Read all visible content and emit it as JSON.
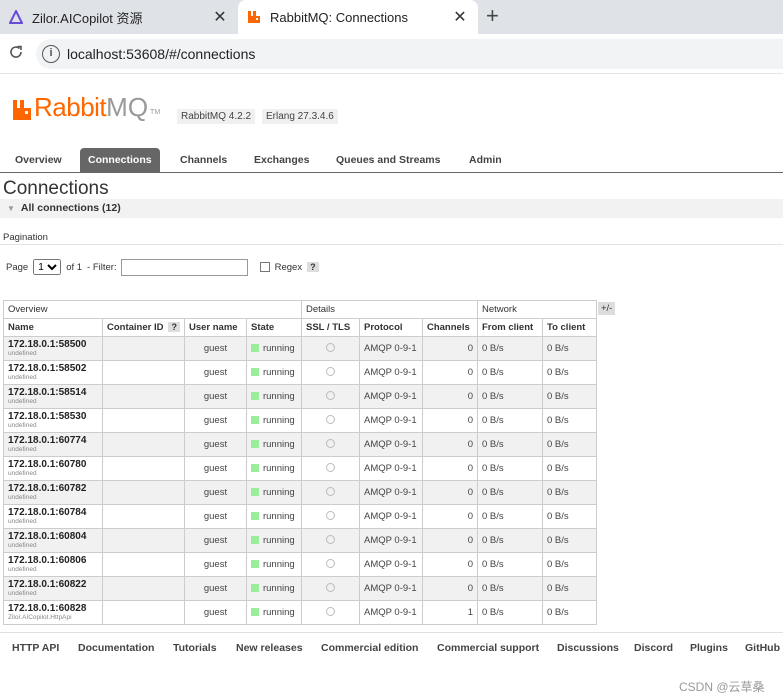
{
  "browser": {
    "tabs": [
      {
        "label": "Zilor.AICopilot 资源",
        "icon": "zilor-triangle-icon"
      },
      {
        "label": "RabbitMQ: Connections",
        "icon": "rabbitmq-icon"
      }
    ],
    "close_glyph": "✕",
    "new_tab_glyph": "+",
    "url": "localhost:53608/#/connections"
  },
  "header": {
    "logo_rabbit": "Rabbit",
    "logo_mq": "MQ",
    "logo_tm": "TM",
    "version": "RabbitMQ 4.2.2",
    "erlang": "Erlang 27.3.4.6"
  },
  "nav": [
    "Overview",
    "Connections",
    "Channels",
    "Exchanges",
    "Queues and Streams",
    "Admin"
  ],
  "page": {
    "title": "Connections",
    "section": "All connections (12)"
  },
  "pagination": {
    "label": "Pagination",
    "page_label": "Page",
    "page_value": "1",
    "of_label": "of 1",
    "filter_label": "- Filter:",
    "regex_label": "Regex",
    "help": "?"
  },
  "table": {
    "groups": [
      "Overview",
      "Details",
      "Network"
    ],
    "plusminus": "+/-",
    "columns": [
      "Name",
      "Container ID",
      "User name",
      "State",
      "SSL / TLS",
      "Protocol",
      "Channels",
      "From client",
      "To client"
    ],
    "rows": [
      {
        "name": "172.18.0.1:58500",
        "sub": "undefined",
        "user": "guest",
        "state": "running",
        "protocol": "AMQP 0-9-1",
        "channels": "0",
        "from": "0 B/s",
        "to": "0 B/s"
      },
      {
        "name": "172.18.0.1:58502",
        "sub": "undefined",
        "user": "guest",
        "state": "running",
        "protocol": "AMQP 0-9-1",
        "channels": "0",
        "from": "0 B/s",
        "to": "0 B/s"
      },
      {
        "name": "172.18.0.1:58514",
        "sub": "undefined",
        "user": "guest",
        "state": "running",
        "protocol": "AMQP 0-9-1",
        "channels": "0",
        "from": "0 B/s",
        "to": "0 B/s"
      },
      {
        "name": "172.18.0.1:58530",
        "sub": "undefined",
        "user": "guest",
        "state": "running",
        "protocol": "AMQP 0-9-1",
        "channels": "0",
        "from": "0 B/s",
        "to": "0 B/s"
      },
      {
        "name": "172.18.0.1:60774",
        "sub": "undefined",
        "user": "guest",
        "state": "running",
        "protocol": "AMQP 0-9-1",
        "channels": "0",
        "from": "0 B/s",
        "to": "0 B/s"
      },
      {
        "name": "172.18.0.1:60780",
        "sub": "undefined",
        "user": "guest",
        "state": "running",
        "protocol": "AMQP 0-9-1",
        "channels": "0",
        "from": "0 B/s",
        "to": "0 B/s"
      },
      {
        "name": "172.18.0.1:60782",
        "sub": "undefined",
        "user": "guest",
        "state": "running",
        "protocol": "AMQP 0-9-1",
        "channels": "0",
        "from": "0 B/s",
        "to": "0 B/s"
      },
      {
        "name": "172.18.0.1:60784",
        "sub": "undefined",
        "user": "guest",
        "state": "running",
        "protocol": "AMQP 0-9-1",
        "channels": "0",
        "from": "0 B/s",
        "to": "0 B/s"
      },
      {
        "name": "172.18.0.1:60804",
        "sub": "undefined",
        "user": "guest",
        "state": "running",
        "protocol": "AMQP 0-9-1",
        "channels": "0",
        "from": "0 B/s",
        "to": "0 B/s"
      },
      {
        "name": "172.18.0.1:60806",
        "sub": "undefined",
        "user": "guest",
        "state": "running",
        "protocol": "AMQP 0-9-1",
        "channels": "0",
        "from": "0 B/s",
        "to": "0 B/s"
      },
      {
        "name": "172.18.0.1:60822",
        "sub": "undefined",
        "user": "guest",
        "state": "running",
        "protocol": "AMQP 0-9-1",
        "channels": "0",
        "from": "0 B/s",
        "to": "0 B/s"
      },
      {
        "name": "172.18.0.1:60828",
        "sub": "Zilor.AICopilot.HttpApi",
        "user": "guest",
        "state": "running",
        "protocol": "AMQP 0-9-1",
        "channels": "1",
        "from": "0 B/s",
        "to": "0 B/s"
      }
    ]
  },
  "footer": [
    "HTTP API",
    "Documentation",
    "Tutorials",
    "New releases",
    "Commercial edition",
    "Commercial support",
    "Discussions",
    "Discord",
    "Plugins",
    "GitHub"
  ],
  "watermark": "CSDN @云草桑",
  "colors": {
    "brand": "#ff6600",
    "running": "#99ee99",
    "nav_active": "#666666"
  }
}
